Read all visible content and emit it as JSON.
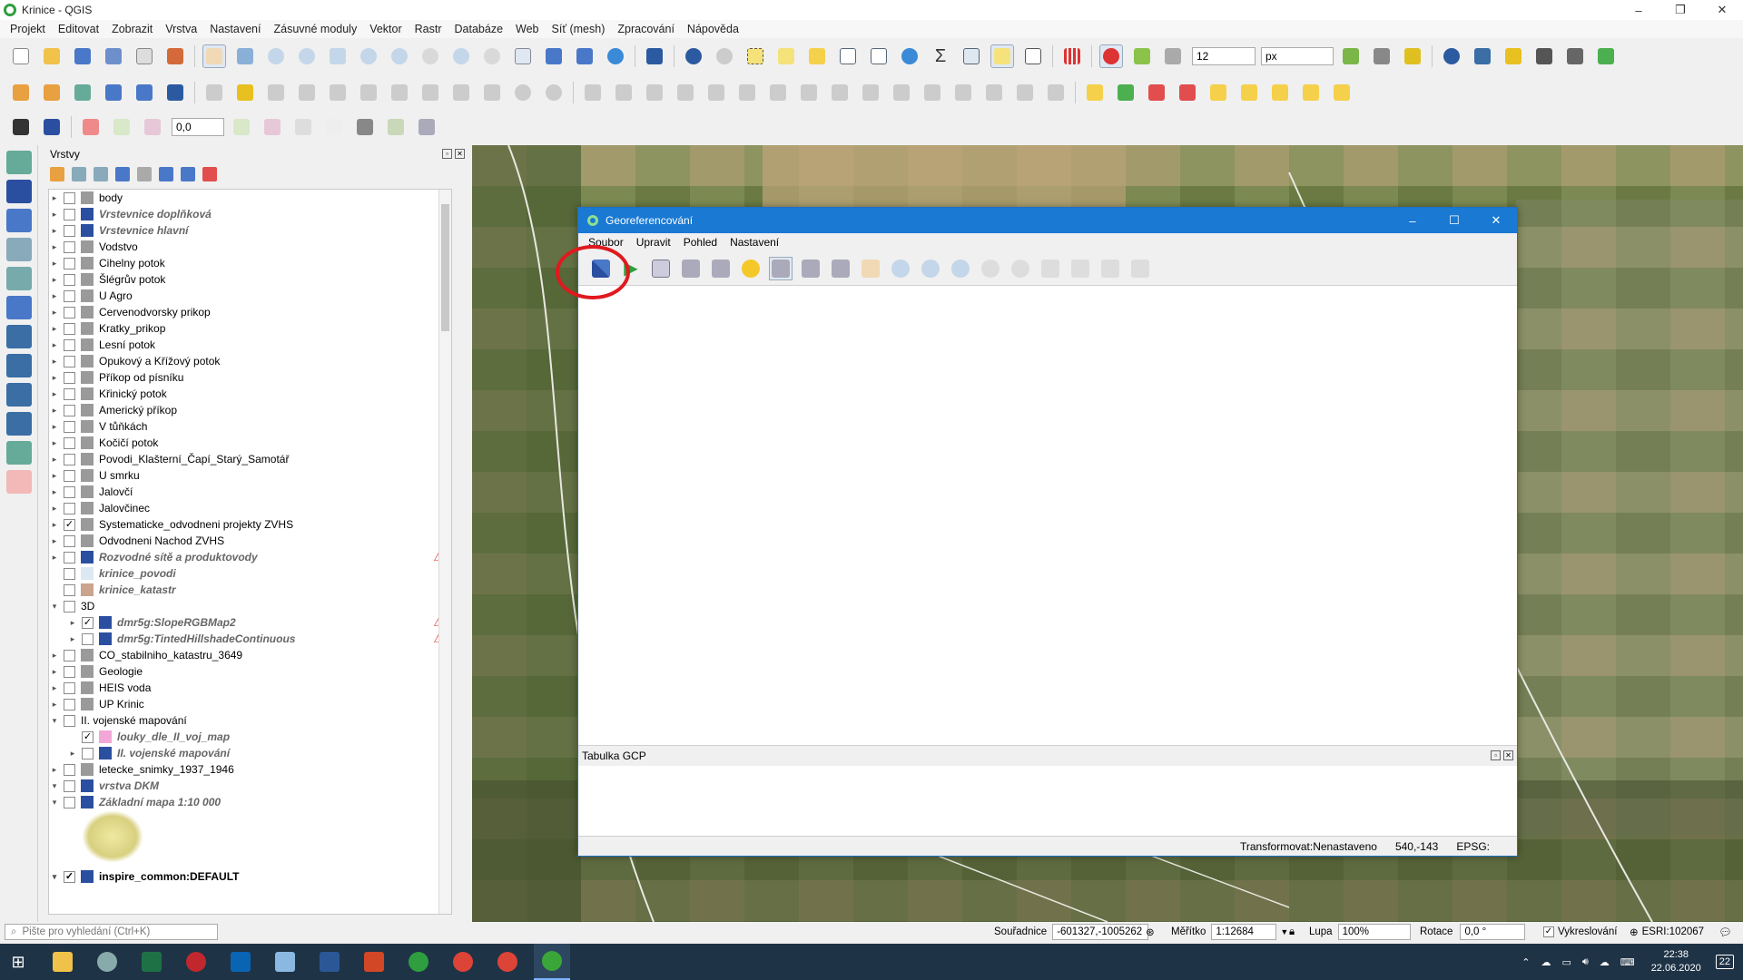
{
  "window": {
    "title": "Krinice - QGIS",
    "min": "–",
    "max": "❐",
    "close": "✕"
  },
  "menu": [
    "Projekt",
    "Editovat",
    "Zobrazit",
    "Vrstva",
    "Nastavení",
    "Zásuvné moduly",
    "Vektor",
    "Rastr",
    "Databáze",
    "Web",
    "Síť (mesh)",
    "Zpracování",
    "Nápověda"
  ],
  "toolbar1": {
    "snap_value": "12",
    "snap_unit": "px"
  },
  "toolbar3": {
    "value": "0,0"
  },
  "layers_panel": {
    "title": "Vrstvy",
    "items": [
      {
        "label": "body",
        "italic": false,
        "checked": false,
        "expander": "▸",
        "color": "#9a9a9a",
        "warn": ""
      },
      {
        "label": "Vrstevnice doplňková",
        "italic": true,
        "checked": false,
        "expander": "▸",
        "color": "#2b4fa0",
        "warn": ""
      },
      {
        "label": "Vrstevnice hlavní",
        "italic": true,
        "checked": false,
        "expander": "▸",
        "color": "#2b4fa0",
        "warn": ""
      },
      {
        "label": "Vodstvo",
        "italic": false,
        "checked": false,
        "expander": "▸",
        "color": "#9a9a9a",
        "warn": ""
      },
      {
        "label": "Cihelny potok",
        "italic": false,
        "checked": false,
        "expander": "▸",
        "color": "#9a9a9a",
        "warn": ""
      },
      {
        "label": "Šlégrův potok",
        "italic": false,
        "checked": false,
        "expander": "▸",
        "color": "#9a9a9a",
        "warn": ""
      },
      {
        "label": "U Agro",
        "italic": false,
        "checked": false,
        "expander": "▸",
        "color": "#9a9a9a",
        "warn": ""
      },
      {
        "label": "Cervenodvorsky prikop",
        "italic": false,
        "checked": false,
        "expander": "▸",
        "color": "#9a9a9a",
        "warn": ""
      },
      {
        "label": "Kratky_prikop",
        "italic": false,
        "checked": false,
        "expander": "▸",
        "color": "#9a9a9a",
        "warn": ""
      },
      {
        "label": "Lesní potok",
        "italic": false,
        "checked": false,
        "expander": "▸",
        "color": "#9a9a9a",
        "warn": ""
      },
      {
        "label": "Opukový a Křížový potok",
        "italic": false,
        "checked": false,
        "expander": "▸",
        "color": "#9a9a9a",
        "warn": ""
      },
      {
        "label": "Příkop od písníku",
        "italic": false,
        "checked": false,
        "expander": "▸",
        "color": "#9a9a9a",
        "warn": ""
      },
      {
        "label": "Křinický potok",
        "italic": false,
        "checked": false,
        "expander": "▸",
        "color": "#9a9a9a",
        "warn": ""
      },
      {
        "label": "Americký příkop",
        "italic": false,
        "checked": false,
        "expander": "▸",
        "color": "#9a9a9a",
        "warn": ""
      },
      {
        "label": "V tůňkách",
        "italic": false,
        "checked": false,
        "expander": "▸",
        "color": "#9a9a9a",
        "warn": ""
      },
      {
        "label": "Kočičí potok",
        "italic": false,
        "checked": false,
        "expander": "▸",
        "color": "#9a9a9a",
        "warn": ""
      },
      {
        "label": "Povodi_Klašterní_Čapí_Starý_Samotář",
        "italic": false,
        "checked": false,
        "expander": "▸",
        "color": "#9a9a9a",
        "warn": ""
      },
      {
        "label": "U smrku",
        "italic": false,
        "checked": false,
        "expander": "▸",
        "color": "#9a9a9a",
        "warn": ""
      },
      {
        "label": "Jalovčí",
        "italic": false,
        "checked": false,
        "expander": "▸",
        "color": "#9a9a9a",
        "warn": ""
      },
      {
        "label": "Jalovčinec",
        "italic": false,
        "checked": false,
        "expander": "▸",
        "color": "#9a9a9a",
        "warn": ""
      },
      {
        "label": "Systematicke_odvodneni projekty ZVHS",
        "italic": false,
        "checked": true,
        "expander": "▸",
        "color": "#9a9a9a",
        "warn": ""
      },
      {
        "label": "Odvodneni Nachod ZVHS",
        "italic": false,
        "checked": false,
        "expander": "▸",
        "color": "#9a9a9a",
        "warn": ""
      },
      {
        "label": "Rozvodné sítě a produktovody",
        "italic": true,
        "checked": false,
        "expander": "▸",
        "color": "#2b4fa0",
        "warn": "⚠"
      },
      {
        "label": "krinice_povodi",
        "italic": true,
        "checked": false,
        "expander": "",
        "color": "#dce9f2",
        "warn": ""
      },
      {
        "label": "krinice_katastr",
        "italic": true,
        "checked": false,
        "expander": "",
        "color": "#caa48c",
        "warn": ""
      },
      {
        "label": "3D",
        "italic": false,
        "checked": false,
        "expander": "▾",
        "color": "",
        "warn": ""
      },
      {
        "label": "dmr5g:SlopeRGBMap2",
        "italic": true,
        "checked": true,
        "expander": "▸",
        "color": "#2b4fa0",
        "warn": "⚠",
        "indent": true
      },
      {
        "label": "dmr5g:TintedHillshadeContinuous",
        "italic": true,
        "checked": false,
        "expander": "▸",
        "color": "#2b4fa0",
        "warn": "⚠",
        "indent": true
      },
      {
        "label": "CO_stabilniho_katastru_3649",
        "italic": false,
        "checked": false,
        "expander": "▸",
        "color": "#9a9a9a",
        "warn": ""
      },
      {
        "label": "Geologie",
        "italic": false,
        "checked": false,
        "expander": "▸",
        "color": "#9a9a9a",
        "warn": ""
      },
      {
        "label": "HEIS voda",
        "italic": false,
        "checked": false,
        "expander": "▸",
        "color": "#9a9a9a",
        "warn": ""
      },
      {
        "label": "UP Krinic",
        "italic": false,
        "checked": false,
        "expander": "▸",
        "color": "#9a9a9a",
        "warn": ""
      },
      {
        "label": "II. vojenské mapování",
        "italic": false,
        "checked": false,
        "expander": "▾",
        "color": "",
        "warn": ""
      },
      {
        "label": "louky_dle_II_voj_map",
        "italic": true,
        "checked": true,
        "expander": "",
        "color": "#f2a7d8",
        "warn": "",
        "indent": true
      },
      {
        "label": "II. vojenské mapování",
        "italic": true,
        "checked": false,
        "expander": "▸",
        "color": "#2b4fa0",
        "warn": "",
        "indent": true
      },
      {
        "label": "letecke_snimky_1937_1946",
        "italic": false,
        "checked": false,
        "expander": "▸",
        "color": "#9a9a9a",
        "warn": ""
      },
      {
        "label": "vrstva DKM",
        "italic": true,
        "checked": false,
        "expander": "▾",
        "color": "#2b4fa0",
        "warn": ""
      },
      {
        "label": "Základní mapa 1:10 000",
        "italic": true,
        "checked": false,
        "expander": "▾",
        "color": "#2b4fa0",
        "warn": ""
      }
    ],
    "bottom_item": {
      "label": "inspire_common:DEFAULT",
      "checked": true
    }
  },
  "statusbar": {
    "search_placeholder": "Pište pro vyhledání (Ctrl+K)",
    "coord_label": "Souřadnice",
    "coord_value": "-601327,-1005262",
    "scale_label": "Měřítko",
    "scale_value": "1:12684",
    "magnifier_label": "Lupa",
    "magnifier_value": "100%",
    "rotation_label": "Rotace",
    "rotation_value": "0,0 °",
    "render_label": "Vykreslování",
    "crs": "ESRI:102067"
  },
  "georef": {
    "title": "Georeferencování",
    "menu": [
      "Soubor",
      "Upravit",
      "Pohled",
      "Nastavení"
    ],
    "gcp_title": "Tabulka GCP",
    "status_transform": "Transformovat:Nenastaveno",
    "status_coords": "540,-143",
    "status_epsg": "EPSG:"
  },
  "taskbar": {
    "time": "22:38",
    "date": "22.06.2020",
    "notif": "22"
  }
}
